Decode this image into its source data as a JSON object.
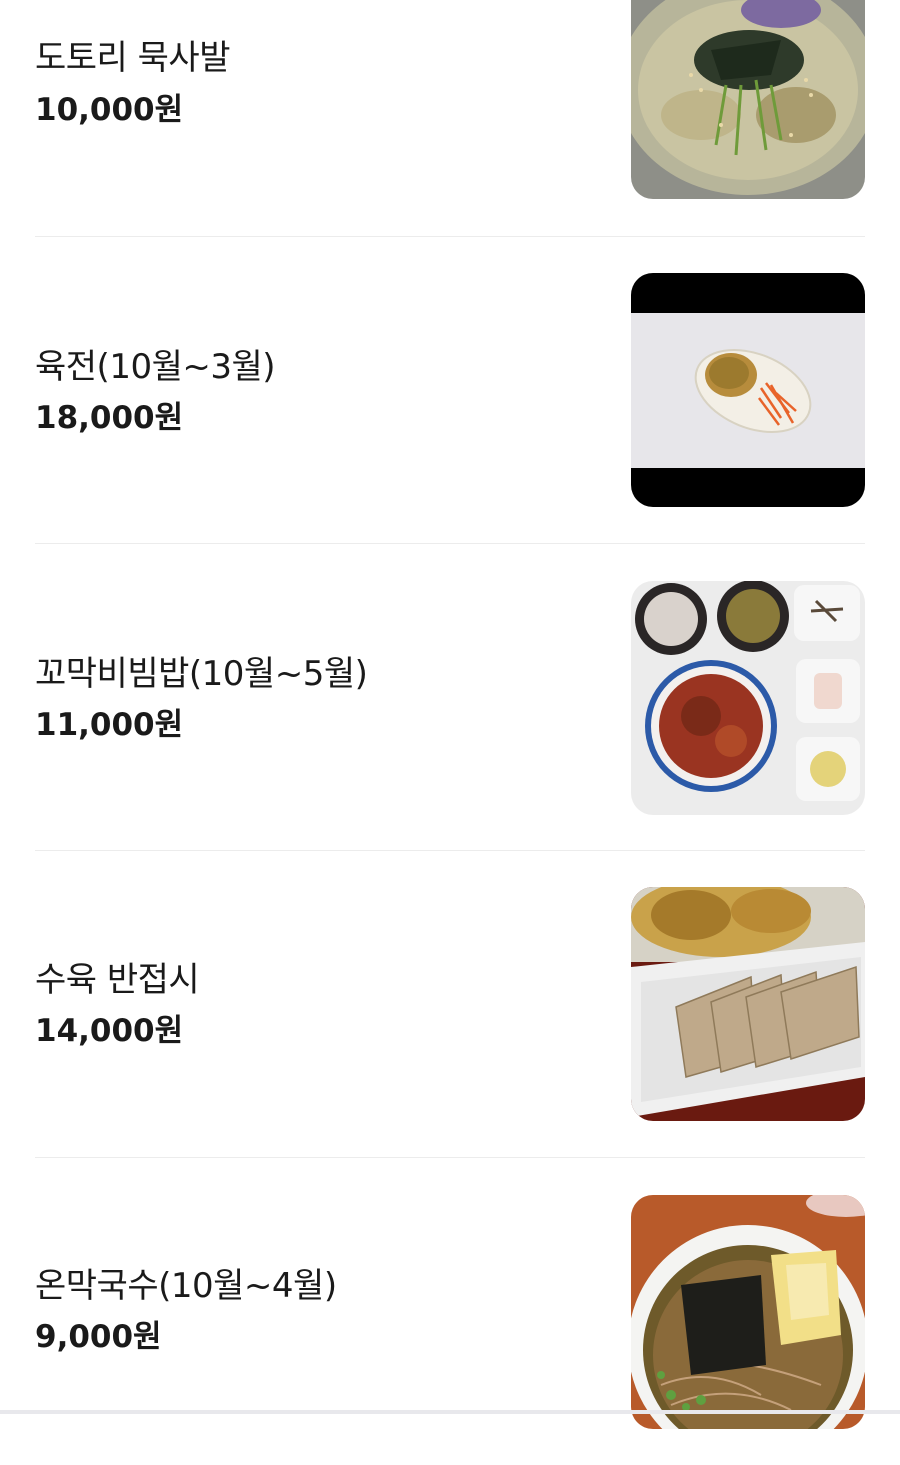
{
  "menu": {
    "items": [
      {
        "name": "도토리 묵사발",
        "price": "10,000원",
        "image": "acorn-jelly-soup-photo"
      },
      {
        "name": "육전(10월~3월)",
        "price": "18,000원",
        "image": "beef-jeon-photo"
      },
      {
        "name": "꼬막비빔밥(10월~5월)",
        "price": "11,000원",
        "image": "cockle-bibimbap-photo"
      },
      {
        "name": "수육 반접시",
        "price": "14,000원",
        "image": "suyuk-half-plate-photo"
      },
      {
        "name": "온막국수(10월~4월)",
        "price": "9,000원",
        "image": "warm-buckwheat-noodle-photo"
      }
    ]
  },
  "colors": {
    "text": "#1a1a1a",
    "divider": "#ececec",
    "background": "#ffffff"
  }
}
